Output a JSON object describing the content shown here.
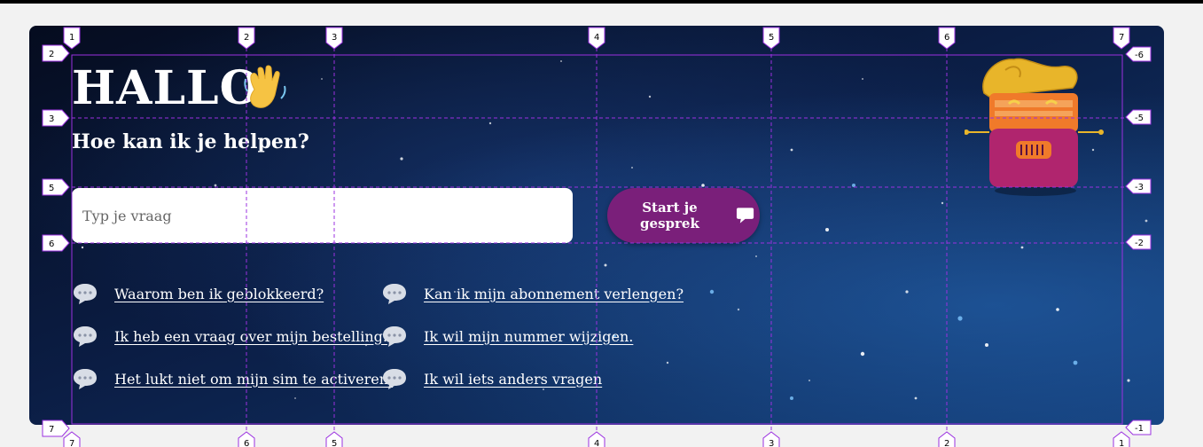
{
  "hero": {
    "title": "HALLO",
    "subtitle": "Hoe kan ik je helpen?",
    "search": {
      "placeholder": "Typ je vraag",
      "value": ""
    },
    "start_button": {
      "label": "Start je gesprek"
    },
    "faq_col1": [
      "Waarom ben ik geblokkeerd?",
      "Ik heb een vraag over mijn bestelling.",
      "Het lukt niet om mijn sim te activeren."
    ],
    "faq_col2": [
      "Kan ik mijn abonnement verlengen?",
      "Ik wil mijn nummer wijzigen.",
      "Ik wil iets anders vragen"
    ]
  },
  "icons": {
    "wave": "waving-hand-icon",
    "chat": "chat-bubble-icon",
    "mascot": "mascot-treasure-box"
  },
  "guides": {
    "top_labels": [
      "1",
      "2",
      "3",
      "4",
      "5",
      "6",
      "7"
    ],
    "bottom_labels": [
      "7",
      "6",
      "5",
      "4",
      "3",
      "2",
      "1"
    ],
    "left_labels": [
      "2",
      "3",
      "5",
      "6",
      "7"
    ],
    "right_labels": [
      "-6",
      "-5",
      "-3",
      "-2",
      "-1"
    ]
  },
  "colors": {
    "accent_purple": "#7a1f7a",
    "guide": "#9b30e0",
    "background": "#f2f2f2",
    "mascot_gold": "#e8b52a",
    "mascot_magenta": "#b0256e",
    "mascot_orange": "#f07a2a"
  }
}
